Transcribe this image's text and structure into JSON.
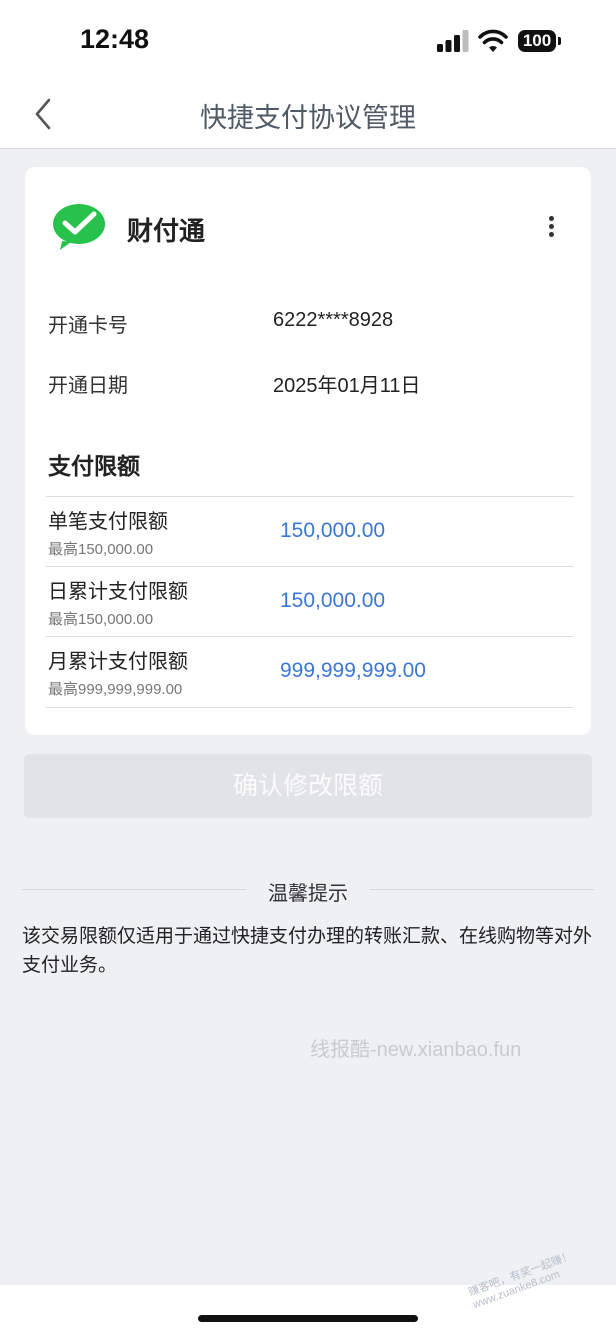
{
  "status_bar": {
    "time": "12:48",
    "battery": "100"
  },
  "nav": {
    "title": "快捷支付协议管理"
  },
  "merchant": {
    "name": "财付通"
  },
  "info": [
    {
      "label": "开通卡号",
      "value": "6222****8928"
    },
    {
      "label": "开通日期",
      "value": "2025年01月11日"
    }
  ],
  "limits_section": {
    "title": "支付限额",
    "rows": [
      {
        "name": "单笔支付限额",
        "max": "最高150,000.00",
        "value": "150,000.00"
      },
      {
        "name": "日累计支付限额",
        "max": "最高150,000.00",
        "value": "150,000.00"
      },
      {
        "name": "月累计支付限额",
        "max": "最高999,999,999.00",
        "value": "999,999,999.00"
      }
    ]
  },
  "confirm_button": {
    "label": "确认修改限额"
  },
  "tips": {
    "title": "温馨提示",
    "text": "该交易限额仅适用于通过快捷支付办理的转账汇款、在线购物等对外支付业务。"
  },
  "watermark": {
    "text": "线报酷-new.xianbao.fun"
  },
  "corner_stamp": {
    "line1": "赚客吧，有奖一起赚！",
    "line2": "www.zuanke8.com"
  },
  "colors": {
    "accent": "#3a78d4",
    "wechat_green": "#27c24c",
    "background": "#eef0f4"
  },
  "icons": {
    "back": "chevron-left-icon",
    "merchant": "wechat-pay-icon",
    "more": "more-vertical-icon"
  }
}
